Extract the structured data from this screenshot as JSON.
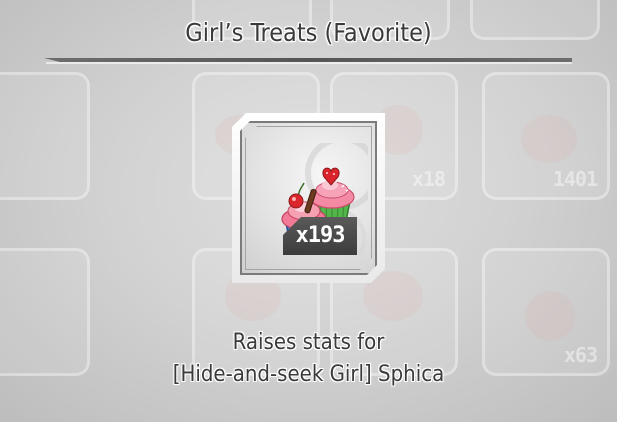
{
  "title": "Girl’s Treats (Favorite)",
  "item": {
    "name": "Girl’s Treats (Favorite)",
    "icon": "cupcakes-icon",
    "count_label": "x193",
    "count": 193
  },
  "description": {
    "line1": "Raises stats for",
    "line2": "[Hide-and-seek Girl] Sphica"
  },
  "background_slots": [
    {
      "count_label": ""
    },
    {
      "count_label": "x18"
    },
    {
      "count_label": "1401"
    },
    {
      "count_label": ""
    },
    {
      "count_label": "x63"
    }
  ],
  "colors": {
    "cupcake_pink_frosting": "#f27a98",
    "cupcake_blue_liner": "#3f7fd8",
    "cupcake_green_liner": "#53b64a",
    "cherry_red": "#d9252b",
    "badge_bg": "#444444"
  }
}
